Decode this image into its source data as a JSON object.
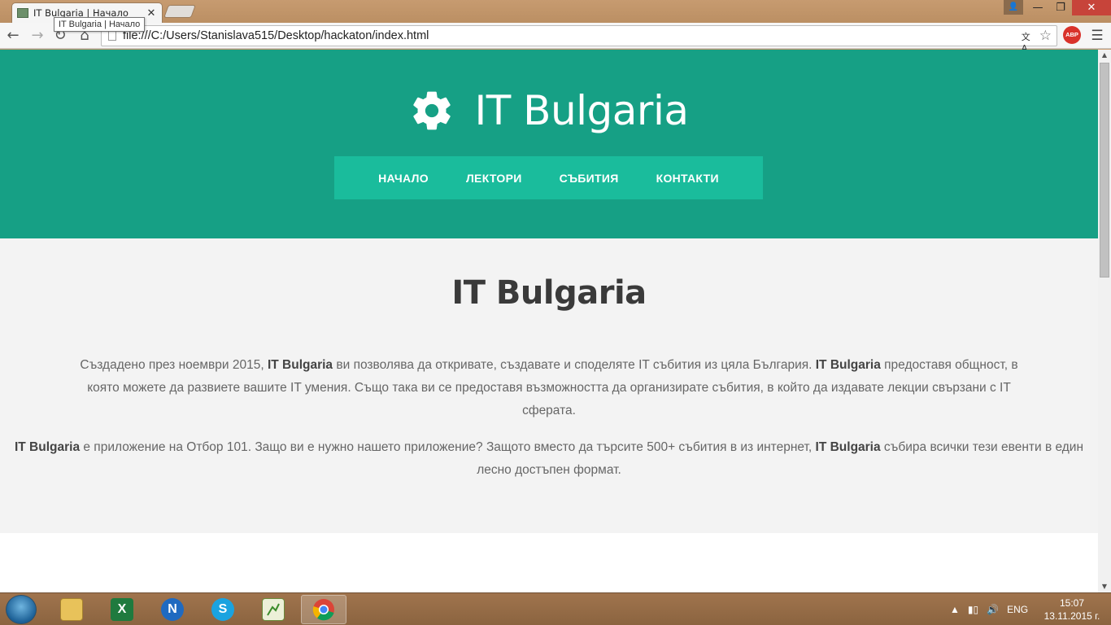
{
  "browser": {
    "tab_title": "IT Bulgaria | Начало",
    "tooltip": "IT Bulgaria | Начало",
    "url": "file:///C:/Users/Stanislava515/Desktop/hackaton/index.html",
    "abp_label": "ABP"
  },
  "site": {
    "brand_title": "IT Bulgaria",
    "nav": [
      {
        "label": "НАЧАЛО"
      },
      {
        "label": "ЛЕКТОРИ"
      },
      {
        "label": "СЪБИТИЯ"
      },
      {
        "label": "КОНТАКТИ"
      }
    ],
    "about_title": "IT Bulgaria",
    "para1": {
      "t1": "Създадено през ноември 2015, ",
      "b1": "IT Bulgaria",
      "t2": " ви позволява да откривате, създавате и споделяте IT събития из цяла България. ",
      "b2": "IT Bulgaria",
      "t3": " предоставя общност, в която можете да развиете вашите IT умения. Също така ви се предоставя възможността да организирате събития, в който да издавате лекции свързани с IT сферата."
    },
    "para2": {
      "b1": "IT Bulgaria",
      "t1": " е приложение на Отбор 101. Защо ви е нужно нашето приложение? Защото вместо да търсите 500+ събития в из интернет, ",
      "b2": "IT Bulgaria",
      "t2": " събира всички тези евенти в един лесно достъпен формат."
    }
  },
  "taskbar": {
    "language": "ENG",
    "time": "15:07",
    "date": "13.11.2015 г.",
    "apps": [
      {
        "name": "file-explorer"
      },
      {
        "name": "excel",
        "glyph": "X"
      },
      {
        "name": "app-n",
        "glyph": "N"
      },
      {
        "name": "skype",
        "glyph": "S"
      },
      {
        "name": "notepad-plus"
      },
      {
        "name": "chrome"
      }
    ]
  },
  "colors": {
    "hero_bg": "#16a085",
    "nav_bg": "#1abc9c",
    "about_bg": "#f3f3f3"
  }
}
